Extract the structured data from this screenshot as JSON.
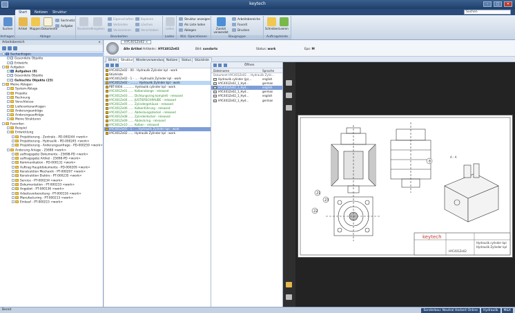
{
  "window": {
    "title": "keytech",
    "controls": [
      "–",
      "□",
      "✕"
    ]
  },
  "ribbon_tabs": [
    {
      "label": "Start",
      "active": true
    },
    {
      "label": "Notizen",
      "active": false
    },
    {
      "label": "Struktur",
      "active": false
    }
  ],
  "search": {
    "value": "Suchen"
  },
  "ribbon": {
    "groups": [
      {
        "label": "Anfragen",
        "buttons": [
          "Suchen"
        ]
      },
      {
        "label": "Ablage",
        "buttons": [
          "Artikel",
          "Mappen",
          "Dokumente"
        ],
        "small": [
          "Sachnotiz",
          "Aufgabe"
        ]
      },
      {
        "label": "Bearbeiten",
        "buttons": [
          "Bearbeiten",
          "Freigeben"
        ],
        "small": [
          "Eigenschaften",
          "Verbinden",
          "Versionieren",
          "Kopieren",
          "Löschen",
          "Verschieben",
          "Bearbeiter",
          "Wechsel"
        ]
      },
      {
        "label": "Laden",
        "buttons": [
          "Laden"
        ]
      },
      {
        "label": "Wzl. Operationen",
        "small": [
          "Struktur anzeigen",
          "Als Liste laden",
          "Ablegen"
        ]
      },
      {
        "label": "Baugruppe",
        "buttons": [
          "Zuletzt verwendet"
        ],
        "small": [
          "Arbeitsbereiche",
          "Favorit",
          "Drucken"
        ]
      },
      {
        "label": "Auftragsleiste",
        "buttons": [
          "Schreiben",
          "Leeren"
        ]
      }
    ]
  },
  "leftpanel": {
    "header": "Arbeitsbereich",
    "close": "× ",
    "tree": [
      {
        "label": "Suchanfragen",
        "level": 0,
        "icon": "blue",
        "sel": true
      },
      {
        "label": "Gesendete Objekte",
        "level": 1,
        "icon": "doc"
      },
      {
        "label": "Entwürfe",
        "level": 1,
        "icon": "doc"
      },
      {
        "label": "Aufgaben",
        "level": 0,
        "icon": "folder"
      },
      {
        "label": "Aufgaben (8)",
        "level": 1,
        "icon": "blue",
        "bold": true
      },
      {
        "label": "Gesendete Objekte",
        "level": 1,
        "icon": "doc"
      },
      {
        "label": "Gelöschte Objekte (23)",
        "level": 1,
        "icon": "doc",
        "bold": true
      },
      {
        "label": "Meine Ablagen",
        "level": 0,
        "icon": "folder"
      },
      {
        "label": "System-Ablage",
        "level": 1,
        "icon": "folder"
      },
      {
        "label": "Projekte",
        "level": 1,
        "icon": "folder"
      },
      {
        "label": "Rechnung",
        "level": 1,
        "icon": "folder"
      },
      {
        "label": "Verschleisse",
        "level": 1,
        "icon": "folder"
      },
      {
        "label": "Lieferantenanfragen",
        "level": 1,
        "icon": "folder"
      },
      {
        "label": "Änderungsanträge",
        "level": 1,
        "icon": "folder"
      },
      {
        "label": "Änderungsaufträge",
        "level": 1,
        "icon": "folder"
      },
      {
        "label": "Meine Strukturen",
        "level": 1,
        "icon": "folder"
      },
      {
        "label": "Favoriten",
        "level": 0,
        "icon": "folder"
      },
      {
        "label": "Beispiel",
        "level": 1,
        "icon": "folder"
      },
      {
        "label": "Entwicklung",
        "level": 1,
        "icon": "folder"
      },
      {
        "label": "Projektierung - Zentrale - PD-000244 <work>",
        "level": 2,
        "icon": "folder"
      },
      {
        "label": "Projektierung - Hydraulik - PD-000245 <work>",
        "level": 2,
        "icon": "folder"
      },
      {
        "label": "Projektierung - Änderungsanfrage - PD-000259 <work>",
        "level": 2,
        "icon": "folder"
      },
      {
        "label": "Änderung Anlage - 25698 <work>",
        "level": 1,
        "icon": "folder"
      },
      {
        "label": "auftragsgebz Dokumente - 25698-PD <work>",
        "level": 2,
        "icon": "folder"
      },
      {
        "label": "auftragsgebz Artikel - 25698-PD <work>",
        "level": 2,
        "icon": "folder"
      },
      {
        "label": "Kommunikation - PD-000131 <work>",
        "level": 2,
        "icon": "folder"
      },
      {
        "label": "Auftrag Hauptdokumente - PD-000209 <work>",
        "level": 2,
        "icon": "folder"
      },
      {
        "label": "Konstruktion Mechanik - PT-000207 <work>",
        "level": 2,
        "icon": "folder"
      },
      {
        "label": "Konstruktion Elektro - PT-000235 <work>",
        "level": 2,
        "icon": "folder"
      },
      {
        "label": "Service - PT-000234 <work>",
        "level": 2,
        "icon": "folder"
      },
      {
        "label": "Dokumentation - PT-000233 <work>",
        "level": 2,
        "icon": "folder"
      },
      {
        "label": "Angebot - PT-000136 <work>",
        "level": 2,
        "icon": "folder"
      },
      {
        "label": "Arbeitsvorbereitung - PT-000116 <work>",
        "level": 2,
        "icon": "folder"
      },
      {
        "label": "Manufacturing - PT-000213 <work>",
        "level": 2,
        "icon": "folder"
      },
      {
        "label": "Einkauf - PT-000215 <work>",
        "level": 2,
        "icon": "folder"
      }
    ]
  },
  "document": {
    "tab": "HYC401Ze02",
    "fields": [
      {
        "label": "Alle Artikel",
        "value": ""
      },
      {
        "label": "Artikelnr.:",
        "value": "HYC401Ze02"
      },
      {
        "label": "Bild:",
        "value": "sondarts"
      },
      {
        "label": "Status:",
        "value": "work"
      },
      {
        "label": "Eps:",
        "value": "M"
      }
    ]
  },
  "subtabs": [
    {
      "label": "Bilder",
      "active": false
    },
    {
      "label": "Struktur",
      "active": true
    },
    {
      "label": "Wiederverwendung",
      "active": false
    },
    {
      "label": "Notizen",
      "active": false
    },
    {
      "label": "Status",
      "active": false
    },
    {
      "label": "Stückliste",
      "active": false
    }
  ],
  "structure": {
    "rows": [
      {
        "text": "HYC401Ze02 - 00 - Hydraulik Zylinder kpl - work",
        "cls": ""
      },
      {
        "text": "Stückliste",
        "cls": ""
      },
      {
        "text": "HYC401Ze02 - 1 - ... - Hydraulik Zylinder kpl - work",
        "cls": ""
      },
      {
        "text": "HYC401Ze02 - ......... Hydraulik Zylinder kpl - work",
        "cls": "hl"
      },
      {
        "text": "PBT-0004 ............ Hydraulik cylinder kpl - work",
        "cls": ""
      },
      {
        "text": "HYC401Ze01 ...... Kolbenstange - released",
        "cls": "green"
      },
      {
        "text": "HYC401Ze03 ...... Dichtungsring komplett - released",
        "cls": "green"
      },
      {
        "text": "HYC401Ze04 ...... JUSTIERSCHRAUBE - released",
        "cls": "green"
      },
      {
        "text": "HYC401Ze05 ...... Zylindergehäuse - released",
        "cls": "green"
      },
      {
        "text": "HYC401Ze06 ...... Kolbenführung - released",
        "cls": "green"
      },
      {
        "text": "HYC401Ze07 ...... Abdeckungsdeckel - released",
        "cls": "green"
      },
      {
        "text": "HYC401Ze08 ...... Zylinderdeckel - released",
        "cls": "green"
      },
      {
        "text": "HYC401Ze09 ...... Abdeckring - released",
        "cls": "green"
      },
      {
        "text": "HYC401Ze10 ...... Kolben - released",
        "cls": "green"
      },
      {
        "text": "HYC401Ze02 - 1 - ... Hydraulik Zylinder kpl - work",
        "cls": "hl2"
      },
      {
        "text": "HYC401Ze02 ...... Hydraulik Zylinder kpl - work",
        "cls": ""
      }
    ]
  },
  "files": {
    "toolbar_label": "Öffnen",
    "columns": [
      "Dateiname",
      "Sprache"
    ],
    "group": "Dokument HYC401Ze02 ... Hydraulik Zylin...",
    "rows": [
      {
        "name": "Hydraulik cylinder (jp)...",
        "lang": "english",
        "sel": false
      },
      {
        "name": "HYC401Ze02_1_Hyd...",
        "lang": "german",
        "sel": false
      },
      {
        "name": "HYC401Ze02_1_Hyd...",
        "lang": "english",
        "sel": true
      },
      {
        "name": "HYC401Ze02_1_Hyd...",
        "lang": "german",
        "sel": false
      },
      {
        "name": "HYC401Ze02_1_Hyd...",
        "lang": "english",
        "sel": false
      },
      {
        "name": "HYC401Ze02_1_Hyd...",
        "lang": "german",
        "sel": false
      }
    ]
  },
  "drawing": {
    "brand": "keytech",
    "title_lines": [
      "Hydraulik cylinder kpl",
      "Hydraulik Zylinder kpl"
    ],
    "number": "HYC401Ze02",
    "section": "A - A",
    "callouts": [
      "21",
      "23",
      "22",
      "8"
    ]
  },
  "statusbar": {
    "left": "Bereit",
    "right": [
      "Sonderbau: Neutral Harbert Online",
      "Hydraulik",
      "M&X"
    ]
  }
}
